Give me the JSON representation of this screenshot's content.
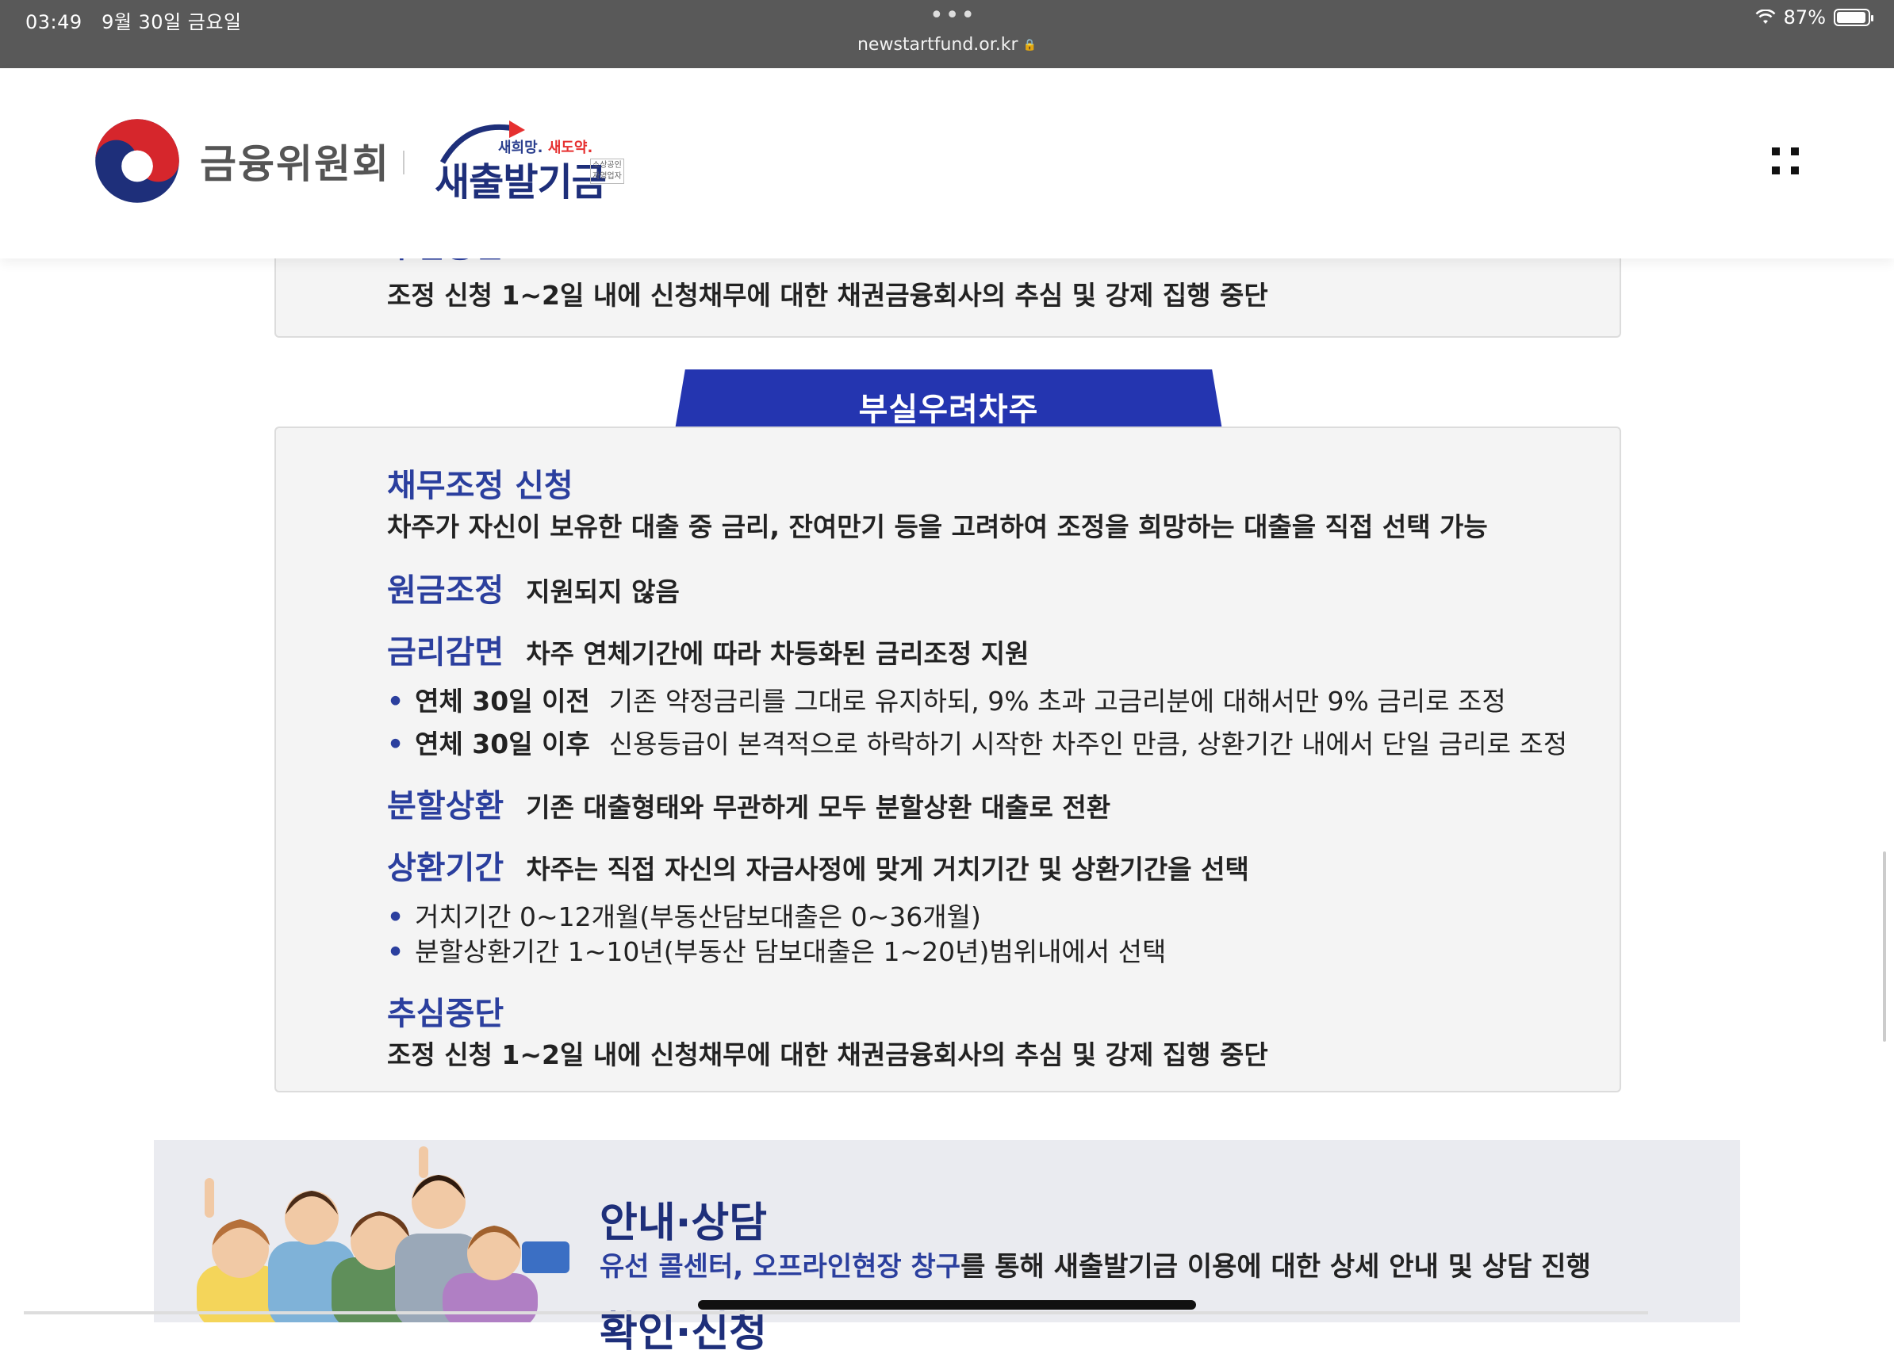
{
  "status_bar": {
    "time": "03:49",
    "date": "9월 30일 금요일",
    "url": "newstartfund.or.kr",
    "battery": "87%"
  },
  "header": {
    "org_name": "금융위원회",
    "fund_slogan_1": "새희망.",
    "fund_slogan_2": "새도약.",
    "fund_name": "새출발기금",
    "fund_sub_1": "소상공인",
    "fund_sub_2": "자영업자"
  },
  "top_box": {
    "cutoff_heading": "추심중단",
    "text": "조정 신청 1~2일 내에 신청채무에 대한 채권금융회사의 추심 및 강제 집행 중단"
  },
  "section_tab": {
    "label": "부실우려차주"
  },
  "section": {
    "debt_adjust": {
      "heading": "채무조정 신청",
      "text": "차주가 자신이 보유한 대출 중 금리, 잔여만기 등을 고려하여 조정을 희망하는 대출을 직접 선택 가능"
    },
    "principal": {
      "heading": "원금조정",
      "text": "지원되지 않음"
    },
    "interest": {
      "heading": "금리감면",
      "text": "차주 연체기간에 따라 차등화된 금리조정 지원",
      "bullets": [
        {
          "label": "연체 30일 이전",
          "text": "기존 약정금리를 그대로 유지하되, 9% 초과 고금리분에 대해서만 9% 금리로 조정"
        },
        {
          "label": "연체 30일 이후",
          "text": "신용등급이 본격적으로 하락하기 시작한 차주인 만큼, 상환기간 내에서 단일 금리로 조정"
        }
      ]
    },
    "installment": {
      "heading": "분할상환",
      "text": "기존 대출형태와 무관하게 모두 분할상환 대출로 전환"
    },
    "repay_period": {
      "heading": "상환기간",
      "text": "차주는 직접 자신의 자금사정에 맞게 거치기간 및 상환기간을 선택",
      "bullets": [
        "거치기간 0~12개월(부동산담보대출은 0~36개월)",
        "분할상환기간 1~10년(부동산 담보대출은 1~20년)범위내에서 선택"
      ]
    },
    "collection_stop": {
      "heading": "추심중단",
      "text": "조정 신청 1~2일 내에 신청채무에 대한 채권금융회사의 추심 및 강제 집행 중단"
    }
  },
  "info_banner": {
    "title": "안내·상담",
    "highlight": "유선 콜센터, 오프라인현장 창구",
    "text": "를 통해 새출발기금 이용에 대한 상세 안내 및 상담 진행",
    "next_title_partial": "확인·신청"
  },
  "icons": [
    "taegeuk-logo",
    "lock-icon",
    "wifi-icon",
    "battery-icon",
    "menu-icon"
  ],
  "colors": {
    "accent": "#2b3f9e",
    "tab": "#2435b0",
    "brand_red": "#e63030",
    "box_bg": "#f4f4f4"
  }
}
